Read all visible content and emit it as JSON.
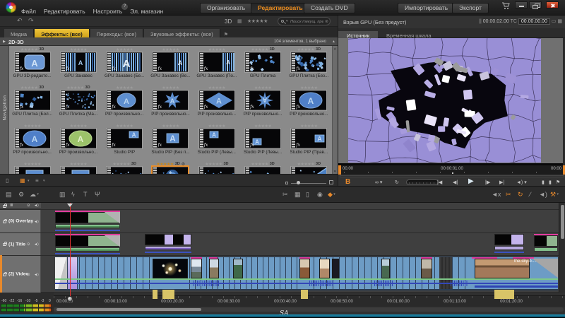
{
  "topbar": {
    "menus": [
      "Файл",
      "Редактировать",
      "Настроить",
      "Эл. магазин"
    ],
    "mode_buttons": [
      {
        "label": "Организовать",
        "active": false
      },
      {
        "label": "Редактировать",
        "active": true
      },
      {
        "label": "Создать DVD",
        "active": false
      }
    ],
    "action_buttons": [
      {
        "label": "Импортировать"
      },
      {
        "label": "Экспорт"
      }
    ]
  },
  "subbar": {
    "undo_icon": "↶",
    "redo_icon": "↷",
    "view_3d_label": "3D",
    "view_grid_icon": "▦",
    "stars": "★★★★★",
    "search_placeholder": "Поиск текущ. представления"
  },
  "library": {
    "tabs": [
      {
        "label": "Медиа",
        "active": false
      },
      {
        "label": "Эффекты: (все)",
        "active": true
      },
      {
        "label": "Переходы: (все)",
        "active": false
      },
      {
        "label": "Звуковые эффекты: (все)",
        "active": false
      }
    ],
    "section_title": "2D-3D",
    "section_count": "104 элементов, 1 выбрано",
    "nav_label": "Navigation",
    "stars": "★★★★★",
    "fx_mark": "fx",
    "effects": [
      {
        "label": "GPU 3D-редакто...",
        "badge": "3D",
        "thumb": "rounded-a"
      },
      {
        "label": "GPU Занавес",
        "badge": "",
        "thumb": "curtain"
      },
      {
        "label": "GPU Занавес (Бе...",
        "badge": "",
        "thumb": "curtain-a"
      },
      {
        "label": "GPU Занавес (Ве...",
        "badge": "",
        "thumb": "curtain-right"
      },
      {
        "label": "GPU Занавес (По...",
        "badge": "",
        "thumb": "curtain-right2"
      },
      {
        "label": "GPU Плитка",
        "badge": "3D",
        "thumb": "tiles-sparse"
      },
      {
        "label": "GPU Плитка (Без...",
        "badge": "3D",
        "thumb": "tiles-dense"
      },
      {
        "label": "GPU Плитка (Бол...",
        "badge": "3D",
        "thumb": "tiles-few"
      },
      {
        "label": "GPU Плитка (Ма...",
        "badge": "3D",
        "thumb": "tiles-tiny"
      },
      {
        "label": "PIP произвольно...",
        "badge": "",
        "thumb": "oval-a"
      },
      {
        "label": "PIP произвольно...",
        "badge": "",
        "thumb": "star-a"
      },
      {
        "label": "PIP произвольно...",
        "badge": "",
        "thumb": "diamond-a"
      },
      {
        "label": "PIP произвольно...",
        "badge": "",
        "thumb": "star2-a"
      },
      {
        "label": "PIP произвольно...",
        "badge": "",
        "thumb": "ellipse-a"
      },
      {
        "label": "PIP произвольно...",
        "badge": "",
        "thumb": "ellipse-a"
      },
      {
        "label": "PIP произвольно...",
        "badge": "",
        "thumb": "ellipse-green"
      },
      {
        "label": "Studio PIP",
        "badge": "",
        "thumb": "pip-tr"
      },
      {
        "label": "Studio PIP (Без п...",
        "badge": "",
        "thumb": "pip-center"
      },
      {
        "label": "Studio PIP (Левы...",
        "badge": "",
        "thumb": "pip-tl"
      },
      {
        "label": "Studio PIP (Левы...",
        "badge": "",
        "thumb": "pip-bl"
      },
      {
        "label": "Studio PIP (Прав...",
        "badge": "",
        "thumb": "pip-r"
      },
      {
        "label": "",
        "badge": "",
        "thumb": "a-center"
      },
      {
        "label": "",
        "badge": "",
        "thumb": "a-center"
      },
      {
        "label": "",
        "badge": "3D",
        "thumb": "shatter-dark"
      },
      {
        "label": "",
        "badge": "3D",
        "thumb": "shatter",
        "selected": true
      },
      {
        "label": "",
        "badge": "3D",
        "thumb": "shatter-dark"
      },
      {
        "label": "",
        "badge": "3D",
        "thumb": "shatter-sparse"
      },
      {
        "label": "",
        "badge": "3D",
        "thumb": "diag"
      }
    ],
    "view_controls": [
      {
        "name": "trash-icon",
        "glyph": "▯",
        "orange": false
      },
      {
        "name": "grid-view-icon",
        "glyph": "▦",
        "orange": true,
        "dd": true
      },
      {
        "name": "list-view-icon",
        "glyph": "≡",
        "orange": false,
        "dd": true
      }
    ]
  },
  "preview": {
    "title": "Взрыв GPU (Без предуст)",
    "pause_glyph": "||",
    "duration": "00.00.02.00",
    "tc_label": "TC",
    "timecode": "00.00.00.00",
    "tabs": [
      {
        "label": "Источник",
        "active": true
      },
      {
        "label": "Временная шкала",
        "active": false
      }
    ],
    "scrub_left": "00.00",
    "scrub_center": "00:00:01.00",
    "scrub_right": "00:00",
    "brand": "B",
    "transport": [
      {
        "name": "loop-mode-icon",
        "glyph": "∞ ▾"
      },
      {
        "name": "repeat-icon",
        "glyph": "↻"
      },
      {
        "name": "jump-start-icon",
        "glyph": "|◀"
      },
      {
        "name": "step-back-icon",
        "glyph": "◀|"
      },
      {
        "name": "play-icon",
        "glyph": "▶",
        "big": true
      },
      {
        "name": "step-forward-icon",
        "glyph": "|▶"
      },
      {
        "name": "jump-end-icon",
        "glyph": "▶|"
      },
      {
        "name": "volume-icon",
        "glyph": "◄) ▾"
      },
      {
        "name": "marker-in-icon",
        "glyph": "▮"
      },
      {
        "name": "marker-out-icon",
        "glyph": "▮"
      },
      {
        "name": "flag-marker-icon",
        "glyph": "⚑"
      }
    ]
  },
  "tl_toolbar": {
    "left": [
      {
        "name": "clapper-icon",
        "glyph": "▤"
      },
      {
        "name": "settings-gear-icon",
        "glyph": "⚙"
      },
      {
        "name": "cloud-icon",
        "glyph": "☁",
        "dd": true
      },
      {
        "name": "audio-mixer-icon",
        "glyph": "▥"
      },
      {
        "name": "magnet-icon",
        "glyph": "ϟ"
      },
      {
        "name": "title-editor-icon",
        "glyph": "T"
      },
      {
        "name": "voiceover-mic-icon",
        "glyph": "Ψ"
      }
    ],
    "mid": [
      {
        "name": "razor-icon",
        "glyph": "✂"
      },
      {
        "name": "grid-icon",
        "glyph": "▦"
      },
      {
        "name": "trash-icon",
        "glyph": "▯"
      },
      {
        "name": "snapshot-camera-icon",
        "glyph": "◉"
      },
      {
        "name": "marker-icon",
        "glyph": "◆",
        "orange": true,
        "dd": true
      }
    ],
    "right": [
      {
        "name": "mute-icon",
        "glyph": "◄x"
      },
      {
        "name": "razor-tool-icon",
        "glyph": "✂",
        "orange": true
      },
      {
        "name": "loop-playback-icon",
        "glyph": "↻",
        "orange": true
      },
      {
        "name": "trim-icon",
        "glyph": "∕"
      },
      {
        "name": "audio-monitor-icon",
        "glyph": "◄)"
      },
      {
        "name": "magic-wand-icon",
        "glyph": "⚒",
        "orange": true,
        "dd": true
      }
    ]
  },
  "timeline": {
    "tracks": [
      {
        "label": "(0) Overlay",
        "selected": false
      },
      {
        "label": "(1) Title",
        "selected": false
      },
      {
        "label": "(2) Video",
        "selected": true
      }
    ],
    "clip_label": "the-sky-b-...",
    "ruler": [
      "00:00.00",
      "00:00:10.00",
      "00:00:20.00",
      "00:00:30.00",
      "00:00:40.00",
      "00:00:50.00",
      "00:01:00.00",
      "00:01:10.00",
      "00:01:20.00"
    ],
    "meter_labels": [
      "-60",
      "-22",
      "-16",
      "-10",
      "-5",
      "-3",
      "0"
    ],
    "watermark": "SA"
  },
  "colors": {
    "accent": "#e8892b",
    "tab_active": "#d8a919",
    "selection": "#e8963c",
    "clip_blue": "#6d9cc5",
    "clip_green": "#83c08c",
    "clip_lavender": "#b7a8e0",
    "magenta": "#e23c9e",
    "preview_purple": "#998fd6"
  }
}
